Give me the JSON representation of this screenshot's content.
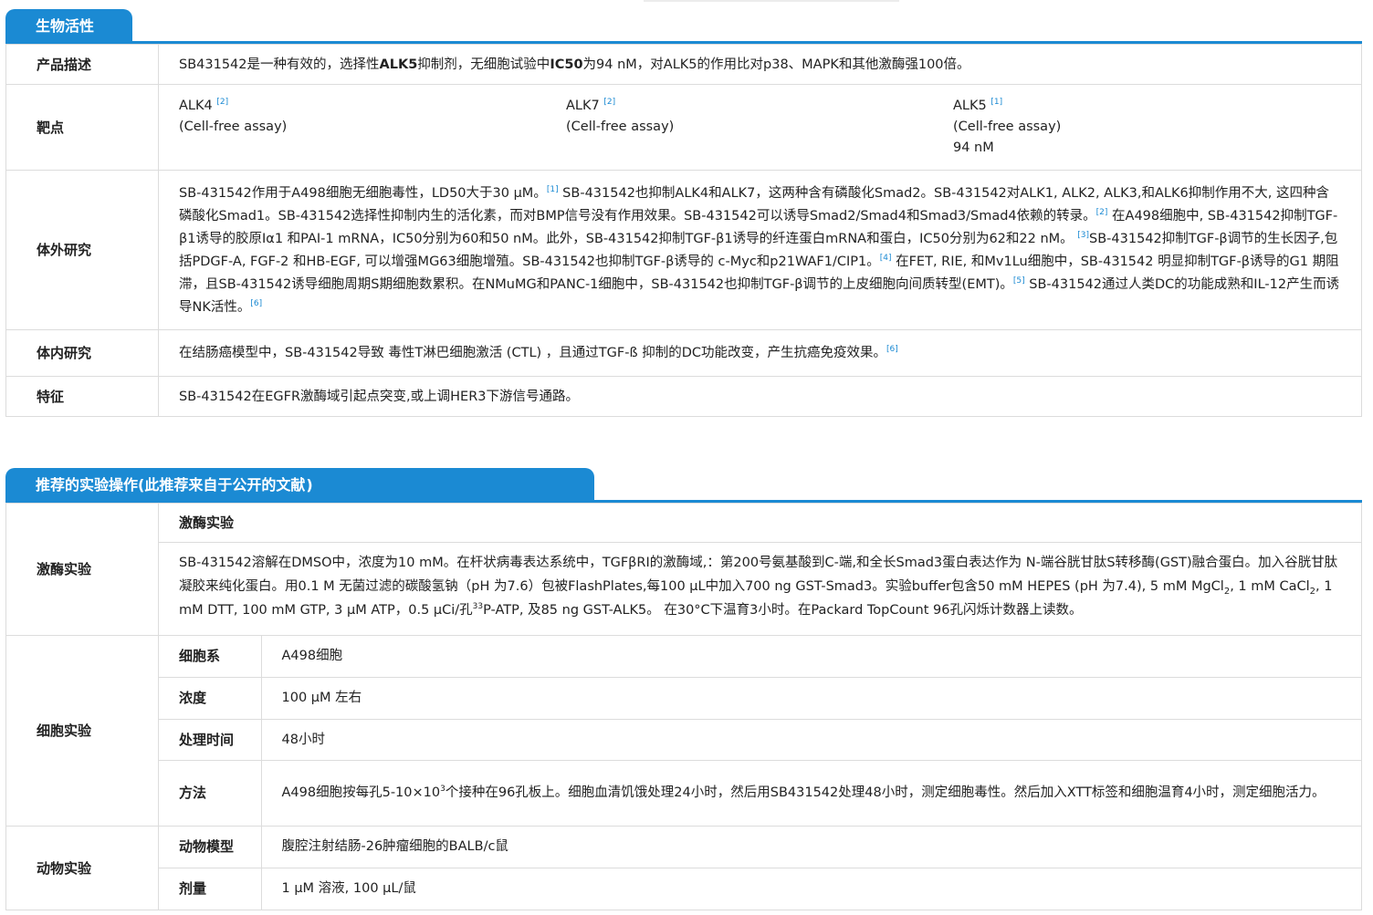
{
  "bio": {
    "title": "生物活性",
    "rows": {
      "desc_label": "产品描述",
      "desc": [
        "SB431542是一种有效的，选择性",
        "ALK5",
        "抑制剂，无细胞试验中",
        "IC50",
        "为94 nM，对ALK5的作用比对p38、MAPK和其他激酶强100倍。"
      ],
      "target_label": "靶点",
      "targets": [
        {
          "name": "ALK4",
          "ref": "[2]",
          "assay": "(Cell-free assay)",
          "value": ""
        },
        {
          "name": "ALK7",
          "ref": "[2]",
          "assay": "(Cell-free assay)",
          "value": ""
        },
        {
          "name": "ALK5",
          "ref": "[1]",
          "assay": "(Cell-free assay)",
          "value": "94 nM"
        }
      ],
      "invitro_label": "体外研究",
      "invitro": [
        "SB-431542作用于A498细胞无细胞毒性，LD50大于30 μM。",
        "[1]",
        " SB-431542也抑制ALK4和ALK7，这两种含有磷酸化Smad2。SB-431542对ALK1, ALK2, ALK3,和ALK6抑制作用不大, 这四种含磷酸化Smad1。SB-431542选择性抑制内生的活化素，而对BMP信号没有作用效果。SB-431542可以诱导Smad2/Smad4和Smad3/Smad4依赖的转录。",
        "[2]",
        " 在A498细胞中, SB-431542抑制TGF-β1诱导的胶原Iα1 和PAI-1 mRNA，IC50分别为60和50 nM。此外，SB-431542抑制TGF-β1诱导的纤连蛋白mRNA和蛋白，IC50分别为62和22 nM。 ",
        "[3]",
        "SB-431542抑制TGF-β调节的生长因子,包括PDGF-A, FGF-2 和HB-EGF, 可以增强MG63细胞增殖。SB-431542也抑制TGF-β诱导的 c-Myc和p21WAF1/CIP1。",
        "[4]",
        " 在FET, RIE, 和Mv1Lu细胞中，SB-431542 明显抑制TGF-β诱导的G1 期阻滞，且SB-431542诱导细胞周期S期细胞数累积。在NMuMG和PANC-1细胞中，SB-431542也抑制TGF-β调节的上皮细胞向间质转型(EMT)。",
        "[5]",
        " SB-431542通过人类DC的功能成熟和IL-12产生而诱导NK活性。",
        "[6]"
      ],
      "invivo_label": "体内研究",
      "invivo": "在结肠癌模型中，SB-431542导致 毒性T淋巴细胞激活 (CTL) ，且通过TGF-ß 抑制的DC功能改变，产生抗癌免疫效果。",
      "invivo_ref": "[6]",
      "feature_label": "特征",
      "feature": "SB-431542在EGFR激酶域引起点突变,或上调HER3下游信号通路。"
    }
  },
  "protocol": {
    "title_main": "推荐的实验操作(此推荐来自于公开的文献",
    "title_close": ")",
    "kinase": {
      "label": "激酶实验",
      "subtitle": "激酶实验",
      "p1": "SB-431542溶解在DMSO中，浓度为10 mM。在杆状病毒表达系统中，TGFβRI的激酶域,：第200号氨基酸到C-端,和全长Smad3蛋白表达作为 N-端谷胱甘肽S转移酶(GST)融合蛋白。加入谷胱甘肽凝胶来纯化蛋白。用0.1 M 无菌过滤的碳酸氢钠（pH 为7.6）包被FlashPlates,每100 µL中加入700 ng GST-Smad3。实验buffer包含50 mM HEPES (pH 为7.4), 5 mM MgCl",
      "sub1": "2",
      "p2": ", 1 mM CaCl",
      "sub2": "2",
      "p3": ", 1 mM DTT, 100 mM GTP, 3 µM ATP，0.5 µCi/孔",
      "sup1": "33",
      "p4": "P-ATP, 及85 ng GST-ALK5。 在30°C下温育3小时。在Packard TopCount 96孔闪烁计数器上读数。"
    },
    "cell": {
      "label": "细胞实验",
      "rows": [
        {
          "k": "细胞系",
          "v": "A498细胞"
        },
        {
          "k": "浓度",
          "v": "100 μM 左右"
        },
        {
          "k": "处理时间",
          "v": "48小时"
        }
      ],
      "method_k": "方法",
      "method_a": "A498细胞按每孔5-10×10",
      "method_sup": "3",
      "method_b": "个接种在96孔板上。细胞血清饥饿处理24小时，然后用SB431542处理48小时，测定细胞毒性。然后加入XTT标签和细胞温育4小时，测定细胞活力。"
    },
    "animal": {
      "label": "动物实验",
      "rows": [
        {
          "k": "动物模型",
          "v": "腹腔注射结肠-26肿瘤细胞的BALB/c鼠"
        },
        {
          "k": "剂量",
          "v": "1 μM 溶液, 100 μL/鼠"
        }
      ]
    }
  }
}
